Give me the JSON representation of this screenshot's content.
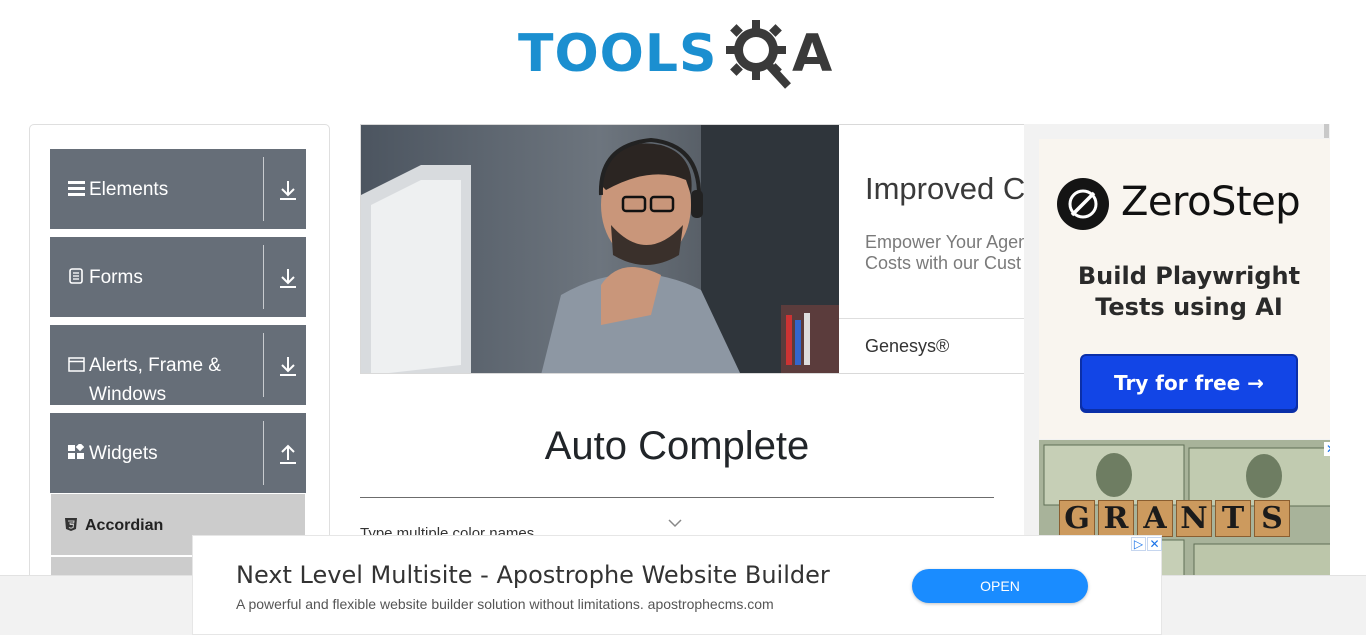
{
  "header": {
    "logo_text": "TOOLS",
    "logo_suffix": "A",
    "logo_alt": "TOOLSQA"
  },
  "sidebar": {
    "groups": [
      {
        "label": "Elements",
        "icon": "hamburger-icon",
        "arrow": "download-icon"
      },
      {
        "label": "Forms",
        "icon": "document-icon",
        "arrow": "download-icon"
      },
      {
        "label": "Alerts, Frame & Windows",
        "icon": "window-icon",
        "arrow": "download-icon"
      },
      {
        "label": "Widgets",
        "icon": "widgets-icon",
        "arrow": "upload-icon"
      }
    ],
    "active_item": {
      "label": "Accordian",
      "icon": "html5-icon"
    }
  },
  "hero_ad": {
    "title": "Improved Cu",
    "description": "Empower Your Agen Costs with our Cust",
    "brand": "Genesys®"
  },
  "main": {
    "title": "Auto Complete",
    "field_label": "Type multiple color names"
  },
  "right_ad": {
    "brand": "ZeroStep",
    "tagline": "Build Playwright Tests using AI",
    "cta": "Try for free →",
    "grants_letters": [
      "G",
      "R",
      "A",
      "N",
      "T",
      "S"
    ],
    "close": "✕"
  },
  "bottom_ad": {
    "title": "Next Level Multisite - Apostrophe Website Builder",
    "subtitle": "A powerful and flexible website builder solution without limitations. apostrophecms.com",
    "button": "OPEN",
    "adchoices": "▷",
    "close": "✕"
  },
  "colors": {
    "sidebar_group": "#666e78",
    "active_item": "#cccccc",
    "logo_blue": "#1b8fd0",
    "cta_blue": "#1245e6",
    "open_blue": "#1a8cff"
  }
}
